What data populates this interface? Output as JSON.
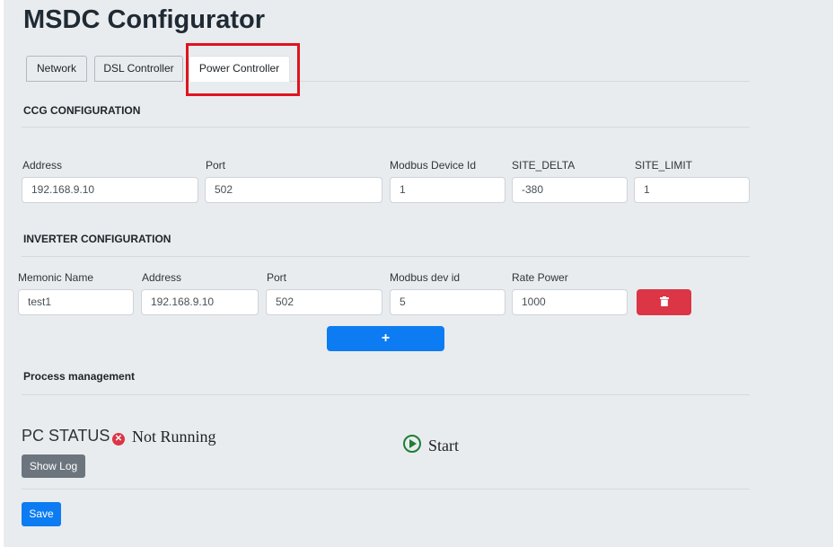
{
  "app": {
    "title": "MSDC Configurator"
  },
  "tabs": [
    {
      "label": "Network"
    },
    {
      "label": "DSL Controller"
    },
    {
      "label": "Power Controller"
    }
  ],
  "ccg": {
    "title": "CCG CONFIGURATION",
    "fields": [
      {
        "label": "Address",
        "value": "192.168.9.10"
      },
      {
        "label": "Port",
        "value": "502"
      },
      {
        "label": "Modbus Device Id",
        "value": "1"
      },
      {
        "label": "SITE_DELTA",
        "value": "-380"
      },
      {
        "label": "SITE_LIMIT",
        "value": "1"
      }
    ]
  },
  "inverter": {
    "title": "INVERTER CONFIGURATION",
    "fields": [
      {
        "label": "Memonic Name",
        "value": "test1"
      },
      {
        "label": "Address",
        "value": "192.168.9.10"
      },
      {
        "label": "Port",
        "value": "502"
      },
      {
        "label": "Modbus dev id",
        "value": "5"
      },
      {
        "label": "Rate Power",
        "value": "1000"
      }
    ],
    "delete_icon": "trash-icon",
    "add_label": "+"
  },
  "process": {
    "title": "Process management",
    "status_label": "PC STATUS",
    "status_text": "Not Running",
    "start_label": "Start",
    "show_log_label": "Show Log"
  },
  "save_label": "Save",
  "colors": {
    "danger": "#dc3545",
    "primary": "#0d7cf2",
    "success": "#1e7e34",
    "secondary": "#6c757d",
    "highlight": "#e0141e"
  }
}
